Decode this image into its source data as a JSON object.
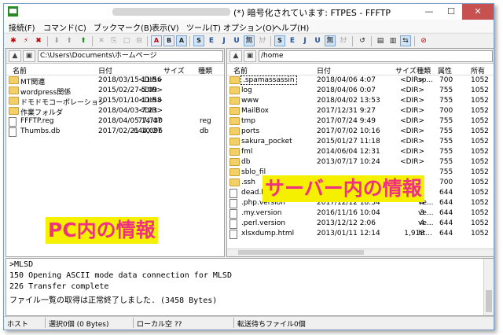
{
  "window": {
    "title": "(*) 暗号化されています: FTPES - FFFTP",
    "min_glyph": "—",
    "max_glyph": "☐",
    "close_glyph": "✕"
  },
  "menu": [
    "接続(F)",
    "コマンド(C)",
    "ブックマーク(B)",
    "表示(V)",
    "ツール(T)",
    "オプション(O)",
    "ヘルプ(H)"
  ],
  "toolbar": {
    "connect_glyph": "✱",
    "quick_connect_glyph": "⚡",
    "disconnect_glyph": "✖",
    "download_glyph": "⬇",
    "upload_glyph": "⬆",
    "mirror_glyph": "⬆",
    "delete_glyph": "✕",
    "rename_glyph": "⎘",
    "mkdir_glyph": "□",
    "cd_glyph": "⊟",
    "mode_a": "A",
    "mode_b": "B",
    "mode_auto": "A",
    "local_kanji": [
      "S",
      "E",
      "J",
      "U"
    ],
    "none_label": "無",
    "kana_label": "ｶﾅ",
    "remote_kanji": [
      "S",
      "E",
      "J",
      "U"
    ],
    "none_label2": "無",
    "kana_label2": "ｶﾅ",
    "refresh_glyph": "↺",
    "list_glyph": "▤",
    "detail_glyph": "▥",
    "sync_glyph": "⇆",
    "stop_glyph": "⊘"
  },
  "local": {
    "path": "C:\\Users\\Documents\\ホームページ",
    "up_glyph": "▲",
    "open_glyph": "▣",
    "columns": {
      "name": "名前",
      "date": "日付",
      "size": "サイズ",
      "type": "種類"
    },
    "files": [
      {
        "icon": "folder",
        "name": "MT関連",
        "date": "2018/03/15 11:56",
        "size": "<DIR>",
        "type": ""
      },
      {
        "icon": "folder",
        "name": "wordpress関係",
        "date": "2015/02/27 5:09",
        "size": "<DIR>",
        "type": ""
      },
      {
        "icon": "folder",
        "name": "ドモドモコーポレーション",
        "date": "2015/01/10 11:58",
        "size": "<DIR>",
        "type": ""
      },
      {
        "icon": "folder",
        "name": "作業フォルダ",
        "date": "2018/04/03 7:23",
        "size": "<DIR>",
        "type": ""
      },
      {
        "icon": "file",
        "name": "FFFTP.reg",
        "date": "2018/04/05 14:47",
        "size": "77,730",
        "type": "reg"
      },
      {
        "icon": "file",
        "name": "Thumbs.db",
        "date": "2017/02/21 10:27",
        "size": "644,096",
        "type": "db"
      }
    ],
    "annotation": "PC内の情報"
  },
  "remote": {
    "path": "/home",
    "up_glyph": "▲",
    "open_glyph": "▣",
    "columns": {
      "name": "名前",
      "date": "日付",
      "size": "サイズ",
      "type": "種類",
      "attr": "属性",
      "owner": "所有"
    },
    "files": [
      {
        "icon": "folder",
        "name": ".spamassassin",
        "date": "2018/04/06 4:07",
        "size": "<DIR>",
        "type": "sp...",
        "attr": "700",
        "owner": "1052"
      },
      {
        "icon": "folder",
        "name": "log",
        "date": "2018/04/06 0:07",
        "size": "<DIR>",
        "type": "",
        "attr": "755",
        "owner": "1052"
      },
      {
        "icon": "folder",
        "name": "www",
        "date": "2018/04/02 13:53",
        "size": "<DIR>",
        "type": "",
        "attr": "755",
        "owner": "1052"
      },
      {
        "icon": "folder",
        "name": "MailBox",
        "date": "2017/12/31 9:27",
        "size": "<DIR>",
        "type": "",
        "attr": "700",
        "owner": "1052"
      },
      {
        "icon": "folder",
        "name": "tmp",
        "date": "2017/07/24 9:49",
        "size": "<DIR>",
        "type": "",
        "attr": "755",
        "owner": "1052"
      },
      {
        "icon": "folder",
        "name": "ports",
        "date": "2017/07/02 10:16",
        "size": "<DIR>",
        "type": "",
        "attr": "755",
        "owner": "1052"
      },
      {
        "icon": "folder",
        "name": "sakura_pocket",
        "date": "2015/01/27 11:18",
        "size": "<DIR>",
        "type": "",
        "attr": "755",
        "owner": "1052"
      },
      {
        "icon": "folder",
        "name": "fml",
        "date": "2014/06/04 12:31",
        "size": "<DIR>",
        "type": "",
        "attr": "755",
        "owner": "1052"
      },
      {
        "icon": "folder",
        "name": "db",
        "date": "2013/07/17 10:24",
        "size": "<DIR>",
        "type": "",
        "attr": "755",
        "owner": "1052"
      },
      {
        "icon": "folder",
        "name": "sblo_fil",
        "date": "",
        "size": "",
        "type": "",
        "attr": "755",
        "owner": "1052"
      },
      {
        "icon": "folder",
        "name": ".ssh",
        "date": "",
        "size": "",
        "type": "",
        "attr": "700",
        "owner": "1052"
      },
      {
        "icon": "file",
        "name": "dead.le",
        "date": "",
        "size": "",
        "type": "",
        "attr": "644",
        "owner": "1052"
      },
      {
        "icon": "file",
        "name": ".php.version",
        "date": "2017/12/12 18:34",
        "size": "4",
        "type": "ve...",
        "attr": "644",
        "owner": "1052"
      },
      {
        "icon": "file",
        "name": ".my.version",
        "date": "2016/11/16 10:04",
        "size": "3",
        "type": "ve...",
        "attr": "644",
        "owner": "1052"
      },
      {
        "icon": "file",
        "name": ".perl.version",
        "date": "2013/12/12 2:06",
        "size": "4",
        "type": "ve...",
        "attr": "644",
        "owner": "1052"
      },
      {
        "icon": "file",
        "name": "xlsxdump.html",
        "date": "2013/01/11 12:14",
        "size": "1,918",
        "type": "ht...",
        "attr": "644",
        "owner": "1052"
      }
    ],
    "annotation": "サーバー内の情報"
  },
  "log": [
    ">MLSD",
    "150 Opening ASCII mode data connection for MLSD",
    "226 Transfer complete",
    "ファイル一覧の取得は正常終了しました. (3458 Bytes)"
  ],
  "status": {
    "host": "ホスト",
    "selected": "選択0個 (0 Bytes)",
    "local_free": "ローカル空 ??",
    "queue": "転送待ちファイル0個"
  },
  "colors": {
    "annotation_bg": "#f5f000",
    "annotation_text": "#f03080",
    "folder": "#f3cf68",
    "close_button": "#c75050"
  }
}
